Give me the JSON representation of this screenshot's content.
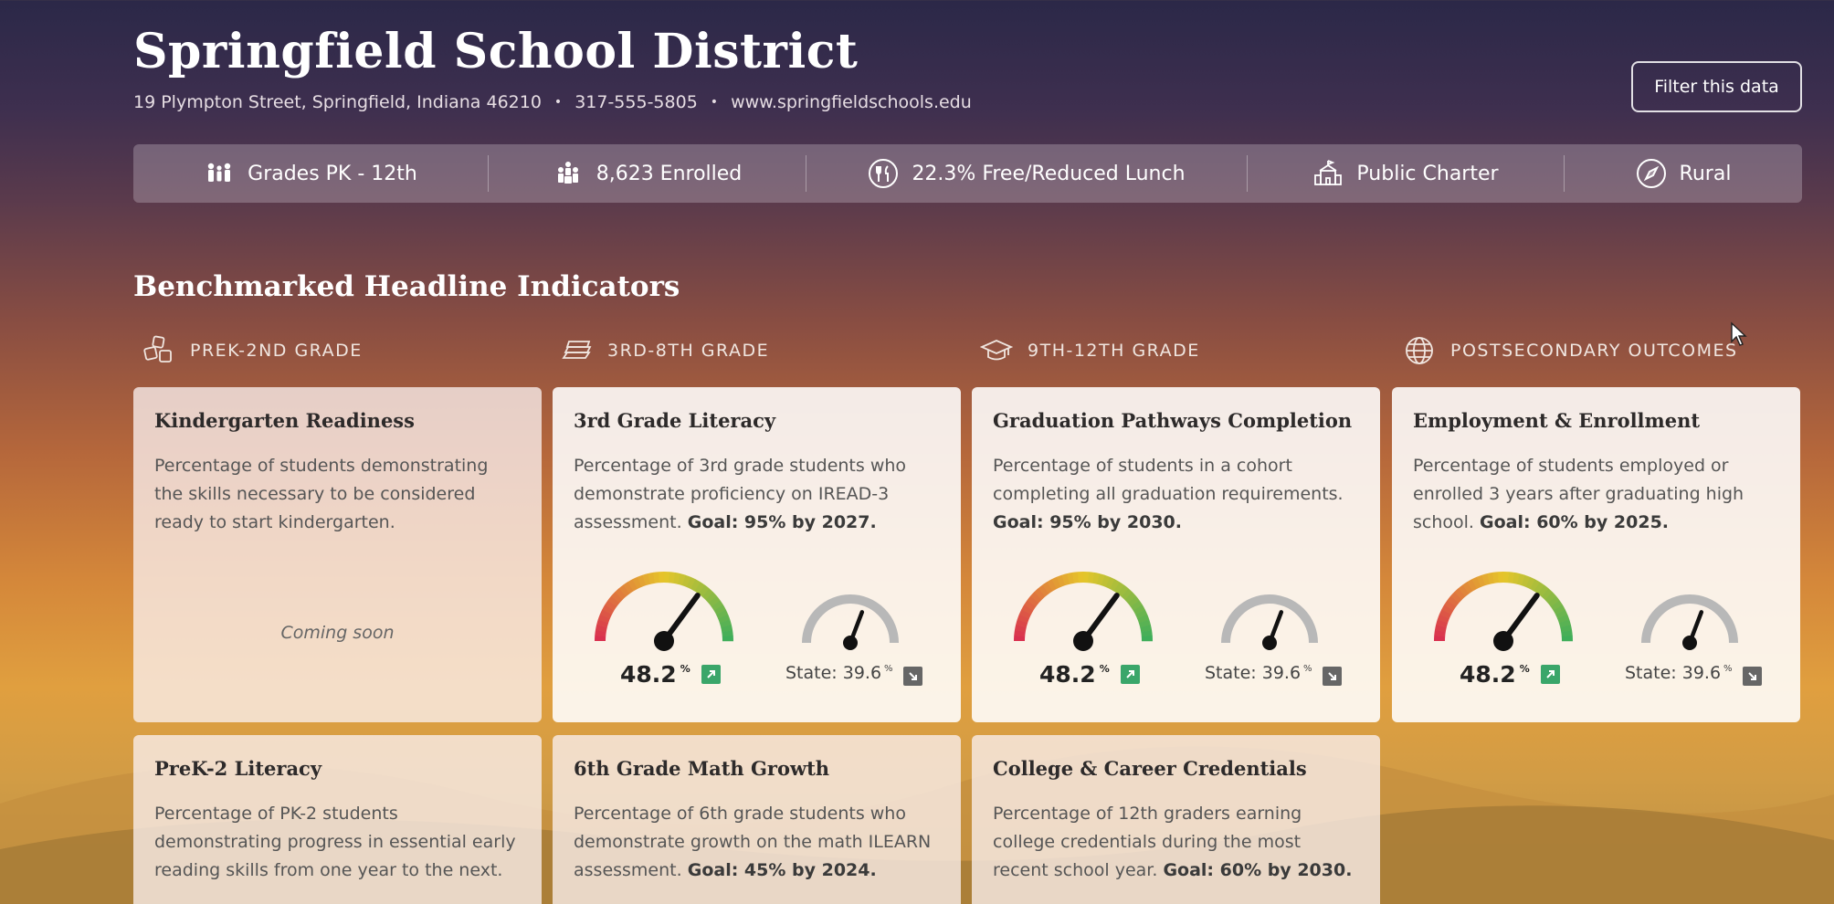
{
  "header": {
    "title": "Springfield School District",
    "address": "19 Plympton Street, Springfield, Indiana 46210",
    "phone": "317-555-5805",
    "website": "www.springfieldschools.edu",
    "filter_label": "Filter this data"
  },
  "stats": [
    {
      "icon": "people-icon",
      "label": "Grades PK - 12th"
    },
    {
      "icon": "group-icon",
      "label": "8,623 Enrolled"
    },
    {
      "icon": "utensils-icon",
      "label": "22.3% Free/Reduced Lunch"
    },
    {
      "icon": "school-building-icon",
      "label": "Public Charter"
    },
    {
      "icon": "compass-icon",
      "label": "Rural"
    }
  ],
  "section_title": "Benchmarked Headline Indicators",
  "columns": [
    {
      "icon": "blocks-icon",
      "label": "PREK-2ND GRADE"
    },
    {
      "icon": "books-icon",
      "label": "3RD-8TH GRADE"
    },
    {
      "icon": "graduation-cap-icon",
      "label": "9TH-12TH GRADE"
    },
    {
      "icon": "globe-icon",
      "label": "POSTSECONDARY OUTCOMES"
    }
  ],
  "cards_row1": [
    {
      "title": "Kindergarten Readiness",
      "desc": "Percentage of students demonstrating the skills necessary to be considered ready to start kindergarten.",
      "status": "Coming soon"
    },
    {
      "title": "3rd Grade Literacy",
      "desc": "Percentage of 3rd grade students who demonstrate proficiency on IREAD-3 assessment.",
      "goal": "Goal: 95% by 2027.",
      "value": "48.2",
      "value_unit": "%",
      "state_label": "State: 39.6",
      "state_unit": "%",
      "value_fraction": 0.482,
      "state_fraction": 0.396
    },
    {
      "title": "Graduation Pathways Completion",
      "desc": "Percentage of students in a cohort completing all graduation requirements.",
      "goal": "Goal: 95% by 2030.",
      "value": "48.2",
      "value_unit": "%",
      "state_label": "State: 39.6",
      "state_unit": "%",
      "value_fraction": 0.482,
      "state_fraction": 0.396
    },
    {
      "title": "Employment & Enrollment",
      "desc": "Percentage of students employed or enrolled 3 years after graduating high school.",
      "goal": "Goal: 60% by 2025.",
      "value": "48.2",
      "value_unit": "%",
      "state_label": "State: 39.6",
      "state_unit": "%",
      "value_fraction": 0.482,
      "state_fraction": 0.396
    }
  ],
  "cards_row2": [
    {
      "title": "PreK-2 Literacy",
      "desc": "Percentage of PK-2 students demonstrating progress in essential early reading skills from one year to the next."
    },
    {
      "title": "6th Grade Math Growth",
      "desc": "Percentage of 6th grade students who demonstrate growth on the math ILEARN assessment.",
      "goal": "Goal: 45% by 2024."
    },
    {
      "title": "College & Career Credentials",
      "desc": "Percentage of 12th graders earning college credentials during the most recent school year.",
      "goal": "Goal: 60% by 2030."
    }
  ],
  "colors": {
    "up_badge": "#3aa66a",
    "down_badge": "#666666",
    "gauge_low": "#d9304f",
    "gauge_mid": "#e6c62a",
    "gauge_high": "#3fae5a",
    "state_gauge": "#b8b8b8"
  }
}
